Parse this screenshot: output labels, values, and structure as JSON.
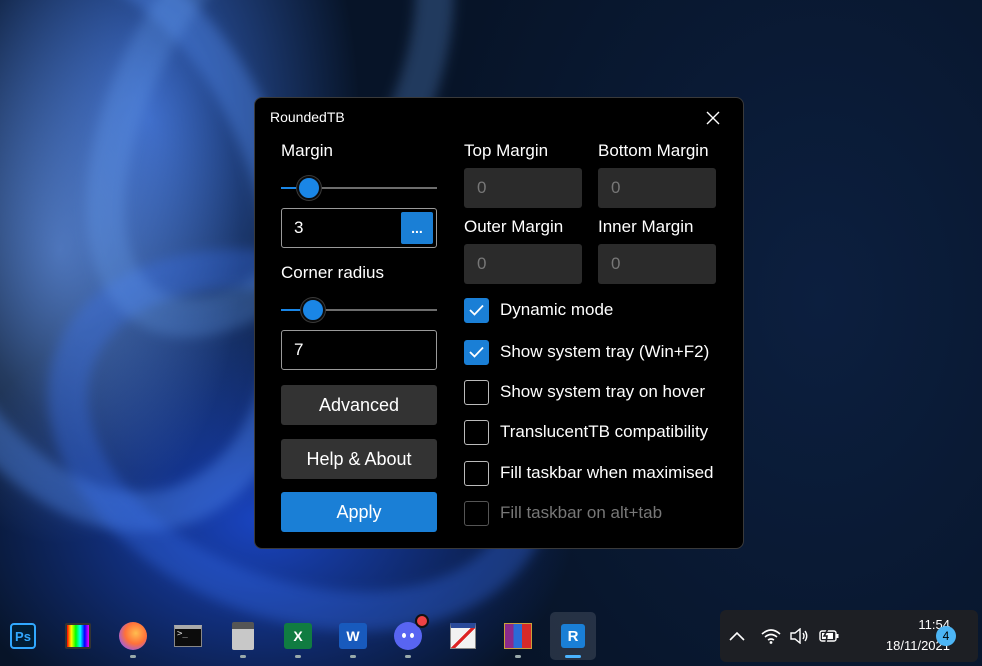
{
  "window": {
    "title": "RoundedTB"
  },
  "left": {
    "margin_label": "Margin",
    "margin_value": "3",
    "margin_more_label": "...",
    "corner_label": "Corner radius",
    "corner_value": "7",
    "advanced_label": "Advanced",
    "help_label": "Help & About",
    "apply_label": "Apply"
  },
  "margins": {
    "top_label": "Top Margin",
    "top_value": "0",
    "bottom_label": "Bottom Margin",
    "bottom_value": "0",
    "outer_label": "Outer Margin",
    "outer_value": "0",
    "inner_label": "Inner Margin",
    "inner_value": "0"
  },
  "options": [
    {
      "label": "Dynamic mode",
      "checked": true,
      "disabled": false
    },
    {
      "label": "Show system tray (Win+F2)",
      "checked": true,
      "disabled": false
    },
    {
      "label": "Show system tray on hover",
      "checked": false,
      "disabled": false
    },
    {
      "label": "TranslucentTB compatibility",
      "checked": false,
      "disabled": false
    },
    {
      "label": "Fill taskbar when maximised",
      "checked": false,
      "disabled": false
    },
    {
      "label": "Fill taskbar on alt+tab",
      "checked": false,
      "disabled": true
    }
  ],
  "taskbar": {
    "apps": [
      {
        "name": "photoshop-icon",
        "label": "Ps"
      },
      {
        "name": "color-app-icon"
      },
      {
        "name": "firefox-icon"
      },
      {
        "name": "terminal-icon",
        "label": ">_"
      },
      {
        "name": "calculator-icon"
      },
      {
        "name": "excel-icon",
        "label": "X"
      },
      {
        "name": "word-icon",
        "label": "W"
      },
      {
        "name": "discord-icon"
      },
      {
        "name": "paint-app-icon"
      },
      {
        "name": "winrar-icon"
      },
      {
        "name": "roundedtb-icon",
        "label": "R"
      }
    ],
    "time": "11:54",
    "date": "18/11/2021",
    "notifications": "4"
  },
  "colors": {
    "accent": "#1a7fd6"
  }
}
